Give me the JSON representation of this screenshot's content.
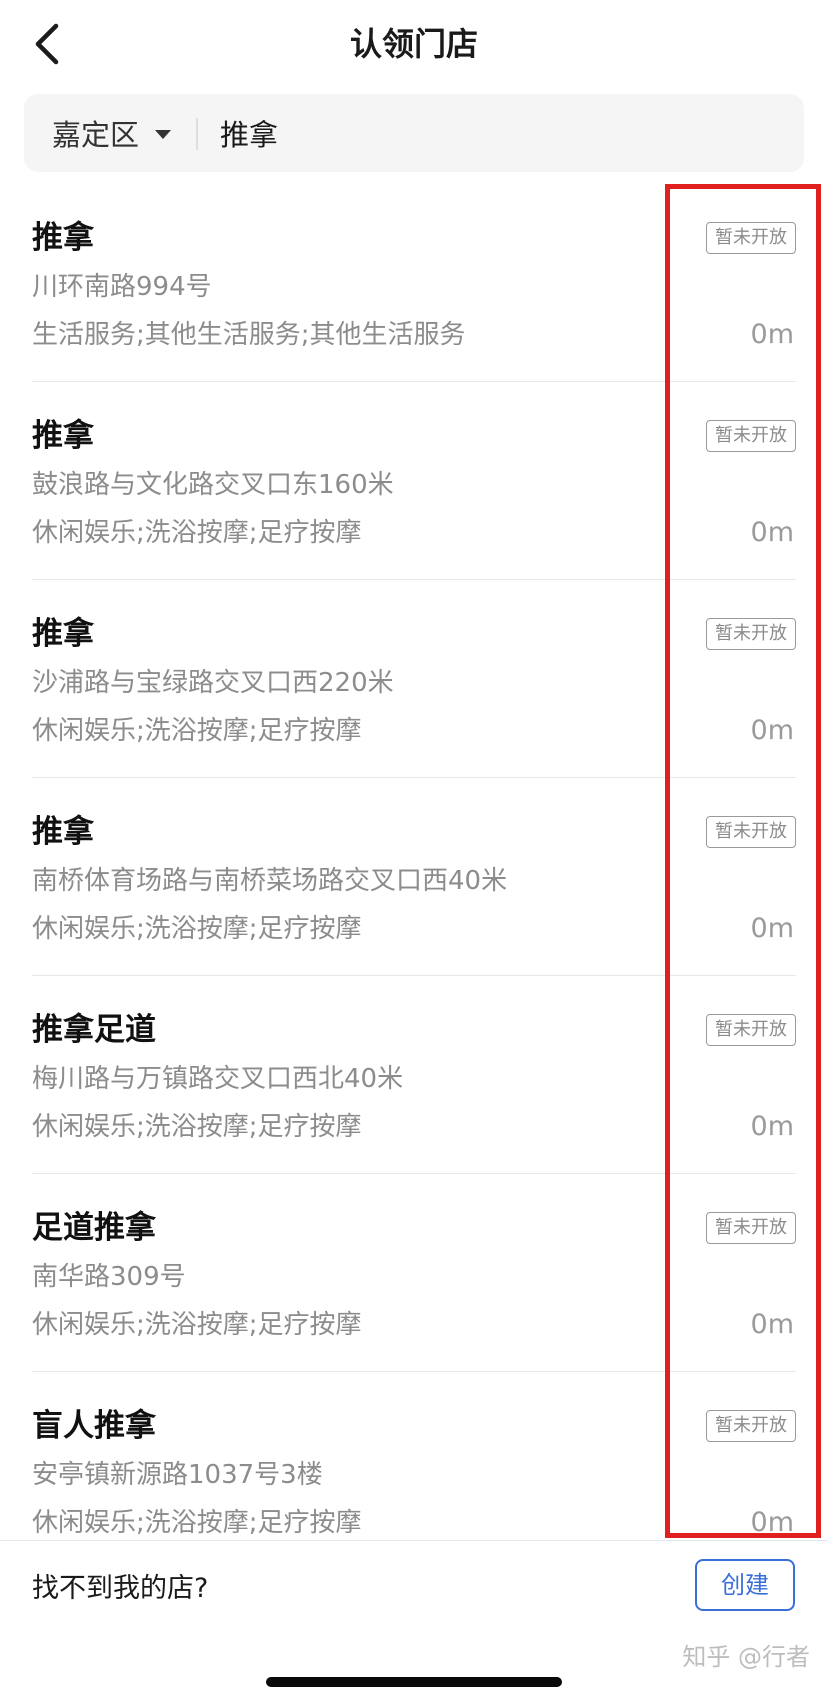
{
  "header": {
    "title": "认领门店",
    "back_icon": "chevron-left-icon"
  },
  "search": {
    "district": "嘉定区",
    "query": "推拿"
  },
  "stores": [
    {
      "name": "推拿",
      "address": "川环南路994号",
      "category": "生活服务;其他生活服务;其他生活服务",
      "status": "暂未开放",
      "distance": "0m"
    },
    {
      "name": "推拿",
      "address": "鼓浪路与文化路交叉口东160米",
      "category": "休闲娱乐;洗浴按摩;足疗按摩",
      "status": "暂未开放",
      "distance": "0m"
    },
    {
      "name": "推拿",
      "address": "沙浦路与宝绿路交叉口西220米",
      "category": "休闲娱乐;洗浴按摩;足疗按摩",
      "status": "暂未开放",
      "distance": "0m"
    },
    {
      "name": "推拿",
      "address": "南桥体育场路与南桥菜场路交叉口西40米",
      "category": "休闲娱乐;洗浴按摩;足疗按摩",
      "status": "暂未开放",
      "distance": "0m"
    },
    {
      "name": "推拿足道",
      "address": "梅川路与万镇路交叉口西北40米",
      "category": "休闲娱乐;洗浴按摩;足疗按摩",
      "status": "暂未开放",
      "distance": "0m"
    },
    {
      "name": "足道推拿",
      "address": "南华路309号",
      "category": "休闲娱乐;洗浴按摩;足疗按摩",
      "status": "暂未开放",
      "distance": "0m"
    },
    {
      "name": "盲人推拿",
      "address": "安亭镇新源路1037号3楼",
      "category": "休闲娱乐;洗浴按摩;足疗按摩",
      "status": "暂未开放",
      "distance": "0m"
    }
  ],
  "footer": {
    "prompt": "找不到我的店?",
    "create_label": "创建",
    "watermark": "知乎 @行者"
  },
  "colors": {
    "accent": "#3a6fd8",
    "highlight": "#e0201f"
  }
}
